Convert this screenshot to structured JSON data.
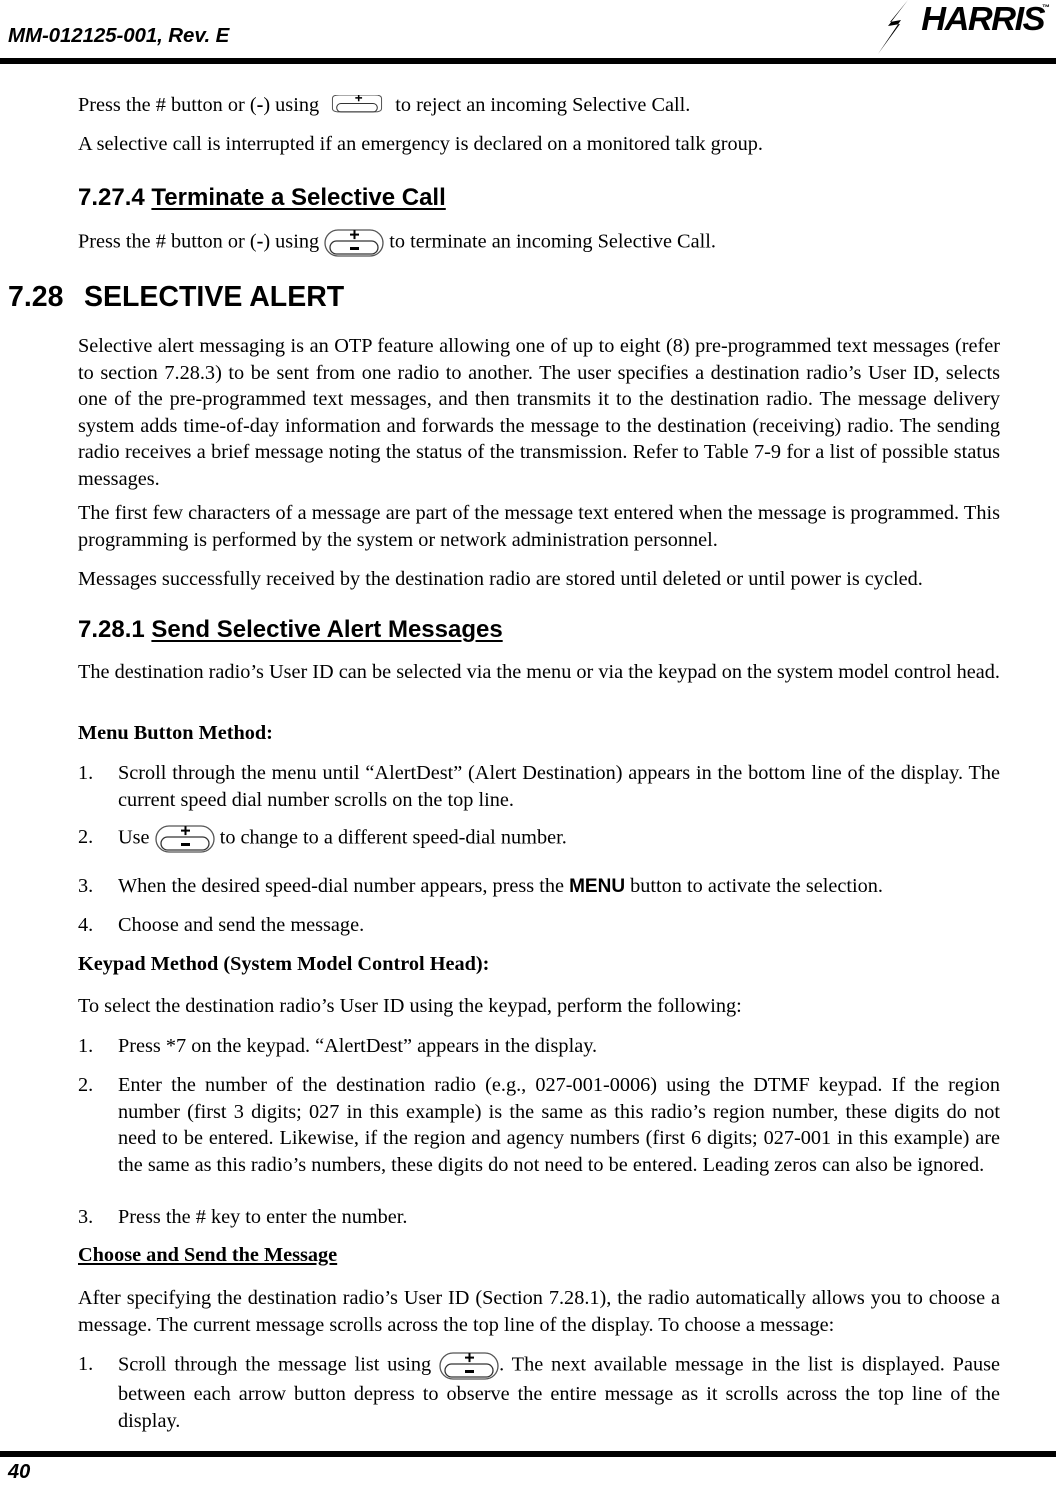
{
  "header": {
    "doc_id": "MM-012125-001, Rev. E",
    "logo_text": "HARRIS",
    "logo_trademark": "™"
  },
  "footer": {
    "page_number": "40"
  },
  "icons": {
    "rocker_plus": "rocker-switch-plus-icon",
    "rocker_plus_minus": "rocker-switch-plus-minus-icon",
    "plus_symbol": "+",
    "minus_symbol": "−"
  },
  "body": {
    "p_reject_pre": "Press the # button or (",
    "p_reject_dash": "-",
    "p_reject_mid": ") using ",
    "p_reject_post": " to reject an incoming Selective Call.",
    "p_emergency": "A selective call is interrupted if an emergency is declared on a monitored talk group.",
    "h_7274_num": "7.27.4",
    "h_7274_title": "Terminate a Selective Call",
    "p_terminate_pre": "Press the # button or (",
    "p_terminate_dash": "-",
    "p_terminate_mid": ") using ",
    "p_terminate_post": " to terminate an incoming Selective Call.",
    "h_728_num": "7.28",
    "h_728_title": "SELECTIVE ALERT",
    "p_overview": "Selective alert messaging is an OTP feature allowing one of up to eight (8) pre-programmed text messages (refer to section 7.28.3) to be sent from one radio to another. The user specifies a destination radio’s User ID, selects one of the pre-programmed text messages, and then transmits it to the destination radio. The message delivery system adds time-of-day information and forwards the message to the destination (receiving) radio. The sending radio receives a brief message noting the status of the transmission. Refer to Table 7-9 for a list of possible status messages.",
    "p_first_few": "The first few characters of a message are part of the message text entered when the message is programmed. This programming is performed by the system or network administration personnel.",
    "p_messages_stored": "Messages successfully received by the destination radio are stored until deleted or until power is cycled.",
    "h_7281_num": "7.28.1",
    "h_7281_title": "Send Selective Alert Messages",
    "p_destination_select": "The destination radio’s User ID can be selected via the menu or via the keypad on the system model control head.",
    "h_menu_method": "Menu Button Method:",
    "menu_list": [
      {
        "num": "1.",
        "text": "Scroll through the menu until “AlertDest” (Alert Destination) appears in the bottom line of the display. The current speed dial number scrolls on the top line."
      },
      {
        "num": "2.",
        "pre": "Use ",
        "post": " to change to a different speed-dial number."
      },
      {
        "num": "3.",
        "pre": "When the desired speed-dial number appears, press the ",
        "strong": "MENU",
        "post": " button to activate the selection."
      },
      {
        "num": "4.",
        "text": "Choose and send the message."
      }
    ],
    "h_keypad_method": "Keypad Method (System Model Control Head):",
    "p_keypad_intro": "To select the destination radio’s User ID using the keypad, perform the following:",
    "keypad_list": [
      {
        "num": "1.",
        "text": "Press *7 on the keypad. “AlertDest” appears in the display."
      },
      {
        "num": "2.",
        "text": "Enter the number of the destination radio (e.g., 027-001-0006) using the DTMF keypad. If the region number (first 3 digits; 027 in this example) is the same as this radio’s region number, these digits do not need to be entered. Likewise, if the region and agency numbers (first 6 digits; 027-001 in this example) are the same as this radio’s numbers, these digits do not need to be entered. Leading zeros can also be ignored."
      },
      {
        "num": "3.",
        "text": "Press the # key to enter the number."
      }
    ],
    "h_choose_send": "Choose and Send the Message",
    "p_after_specifying": "After specifying the destination radio’s User ID (Section 7.28.1), the radio automatically allows you to choose a message. The current message scrolls across the top line of the display. To choose a message:",
    "choose_list": [
      {
        "num": "1.",
        "pre": "Scroll through the message list using ",
        "post": ". The next available message in the list is displayed. Pause between each arrow button depress to observe the entire message as it scrolls across the top line of the display."
      }
    ]
  }
}
